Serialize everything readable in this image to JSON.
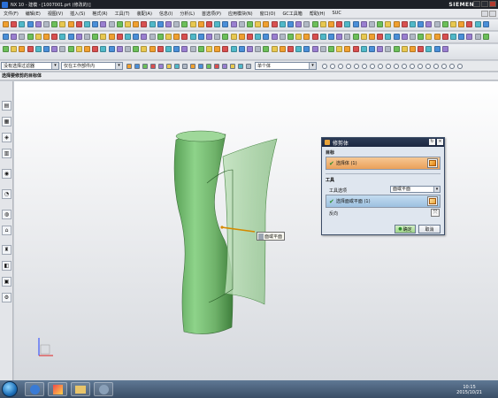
{
  "window": {
    "title": "NX 10 - 建模 - [1007001.prt (修改的)]",
    "brand": "SIEMENS"
  },
  "menubar": {
    "items": [
      "文件(F)",
      "编辑(E)",
      "视图(V)",
      "插入(S)",
      "格式(R)",
      "工具(T)",
      "装配(A)",
      "信息(I)",
      "分析(L)",
      "首选项(P)",
      "应用模块(N)",
      "窗口(O)",
      "GC工具箱",
      "帮助(H)",
      "SUC"
    ]
  },
  "selection_bar": {
    "filter": "没有选择过滤器",
    "scope": "仅在工作部件内",
    "body_filter": "单个体"
  },
  "cue_line": "选择要修剪的目标体",
  "dialog": {
    "title": "修剪体",
    "target_group": "目标",
    "target_row": "选择体 (1)",
    "tool_group": "工具",
    "tool_option_label": "工具选项",
    "tool_option_value": "面或平面",
    "tool_row": "选择面或平面 (1)",
    "direction_label": "反向",
    "ok": "确定",
    "cancel": "取消"
  },
  "viewport": {
    "handle_label": "面或平面"
  },
  "taskbar": {
    "time": "10:15",
    "date": "2015/10/21"
  },
  "colors": {
    "body_green": "#6fb26a",
    "sheet_green": "#a9d4a4",
    "target_row": "#f0b378",
    "tool_row": "#a9c9e6",
    "ok_button": "#b7e0a5"
  }
}
